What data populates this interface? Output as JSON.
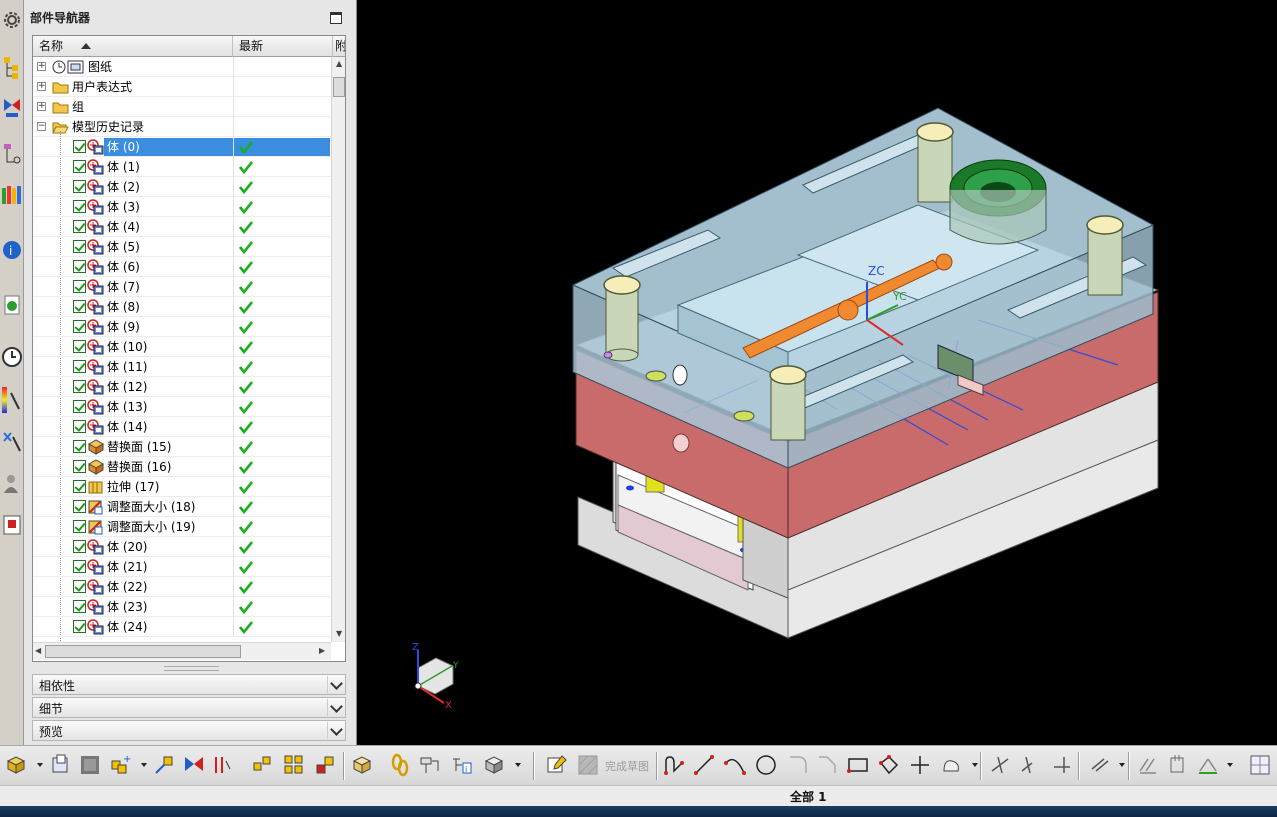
{
  "navigator": {
    "title": "部件导航器",
    "columns": {
      "name": "名称",
      "latest": "最新",
      "extra": "附"
    },
    "nodes": [
      {
        "label": "图纸",
        "icon": "drawing-icon",
        "expander": "+"
      },
      {
        "label": "用户表达式",
        "icon": "folder-icon",
        "expander": "+"
      },
      {
        "label": "组",
        "icon": "folder-icon",
        "expander": "+"
      },
      {
        "label": "模型历史记录",
        "icon": "folder-open-icon",
        "expander": "−"
      }
    ],
    "features": [
      {
        "label": "体 (0)",
        "icon": "body-icon",
        "selected": true
      },
      {
        "label": "体 (1)",
        "icon": "body-icon"
      },
      {
        "label": "体 (2)",
        "icon": "body-icon"
      },
      {
        "label": "体 (3)",
        "icon": "body-icon"
      },
      {
        "label": "体 (4)",
        "icon": "body-icon"
      },
      {
        "label": "体 (5)",
        "icon": "body-icon"
      },
      {
        "label": "体 (6)",
        "icon": "body-icon"
      },
      {
        "label": "体 (7)",
        "icon": "body-icon"
      },
      {
        "label": "体 (8)",
        "icon": "body-icon"
      },
      {
        "label": "体 (9)",
        "icon": "body-icon"
      },
      {
        "label": "体 (10)",
        "icon": "body-icon"
      },
      {
        "label": "体 (11)",
        "icon": "body-icon"
      },
      {
        "label": "体 (12)",
        "icon": "body-icon"
      },
      {
        "label": "体 (13)",
        "icon": "body-icon"
      },
      {
        "label": "体 (14)",
        "icon": "body-icon"
      },
      {
        "label": "替换面 (15)",
        "icon": "replace-face-icon"
      },
      {
        "label": "替换面 (16)",
        "icon": "replace-face-icon"
      },
      {
        "label": "拉伸 (17)",
        "icon": "extrude-icon"
      },
      {
        "label": "调整面大小 (18)",
        "icon": "resize-face-icon"
      },
      {
        "label": "调整面大小 (19)",
        "icon": "resize-face-icon"
      },
      {
        "label": "体 (20)",
        "icon": "body-icon"
      },
      {
        "label": "体 (21)",
        "icon": "body-icon"
      },
      {
        "label": "体 (22)",
        "icon": "body-icon"
      },
      {
        "label": "体 (23)",
        "icon": "body-icon"
      },
      {
        "label": "体 (24)",
        "icon": "body-icon"
      }
    ]
  },
  "panels": {
    "dependencies": "相依性",
    "details": "细节",
    "preview": "预览"
  },
  "viewport": {
    "axis_label_zc": "ZC",
    "axis_label_yc": "YC",
    "triad_z": "Z",
    "triad_x": "X",
    "triad_y": "Y"
  },
  "toolbar": {
    "finish_sketch": "完成草图"
  },
  "status": {
    "text": "全部 1"
  },
  "colors": {
    "selection": "#3b8de0",
    "plate_red": "#c96b6b",
    "plate_blue": "#8fb7c9",
    "handle_orange": "#f0892f"
  }
}
